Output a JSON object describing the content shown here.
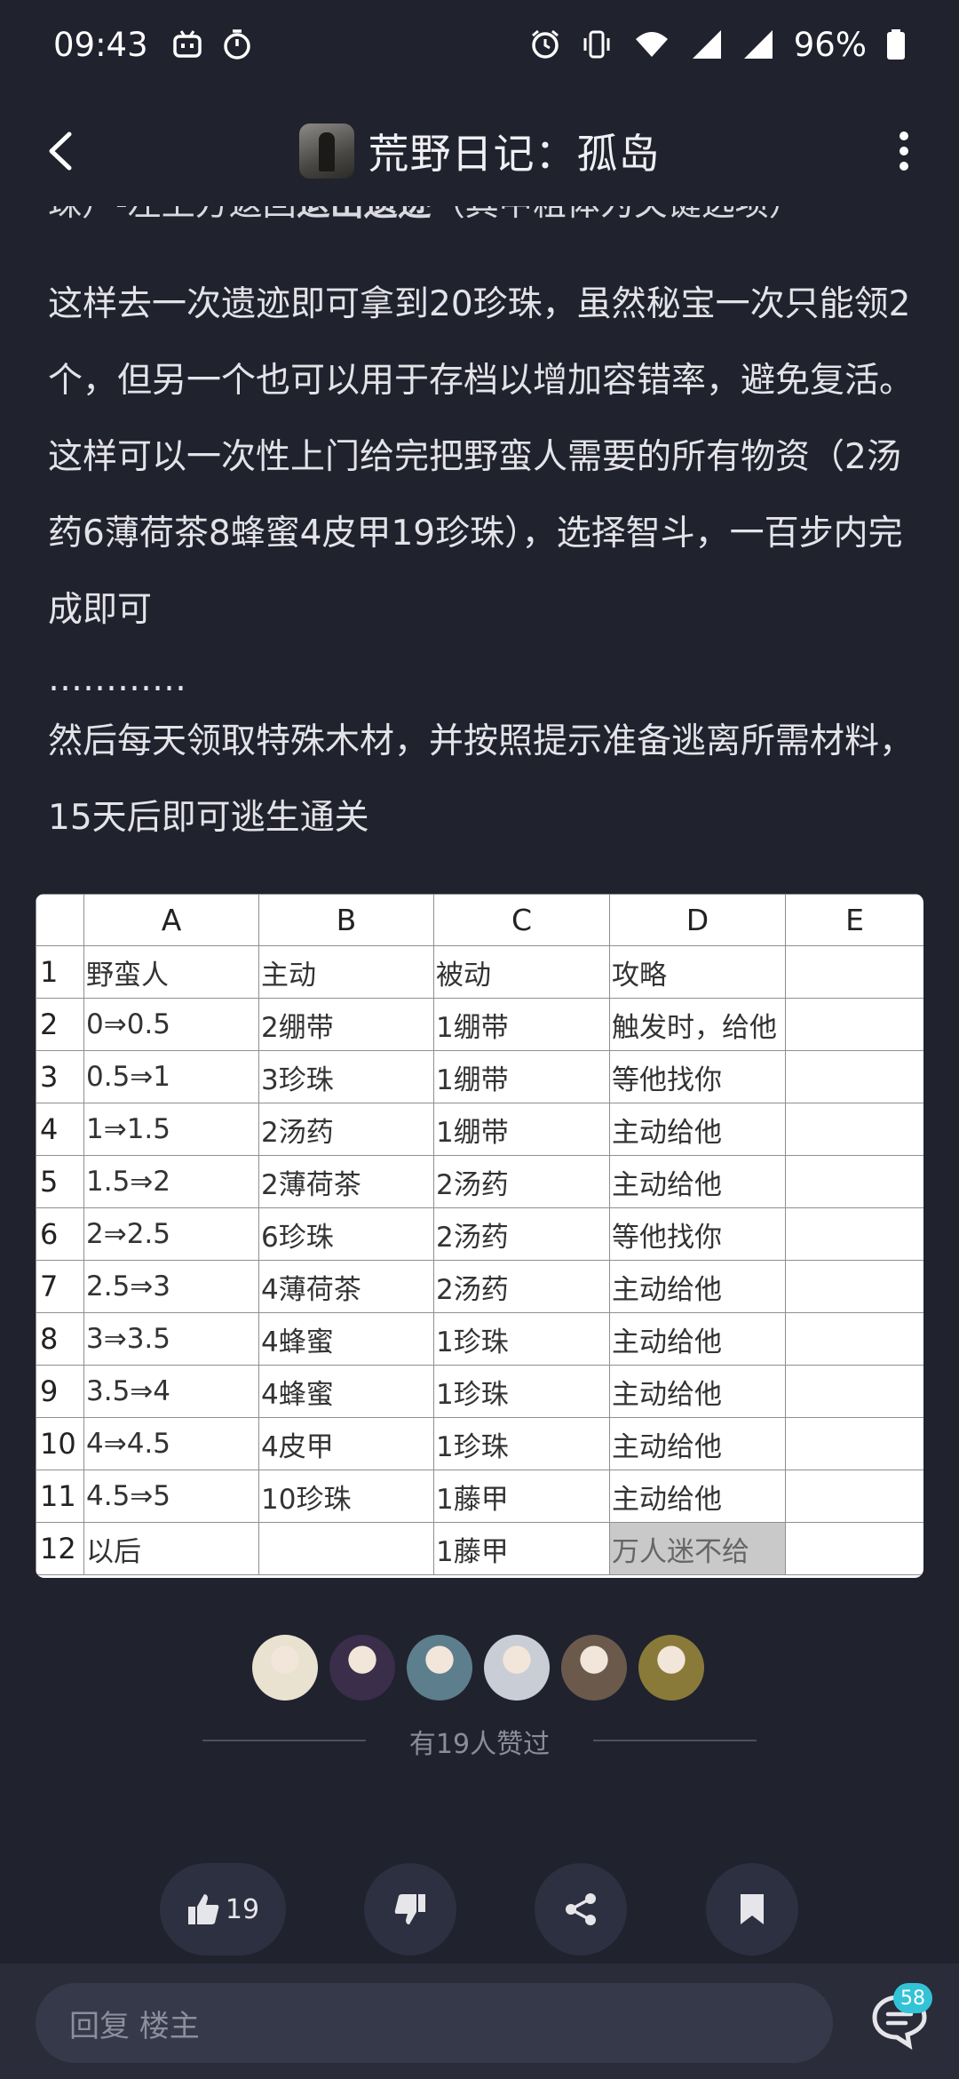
{
  "status_bar": {
    "time": "09:43",
    "battery": "96%",
    "icons": [
      "bilibili-icon",
      "timer-icon",
      "alarm-icon",
      "vibrate-icon",
      "wifi-icon",
      "signal-icon",
      "signal-icon",
      "battery-icon"
    ]
  },
  "header": {
    "title": "荒野日记：孤岛",
    "back_icon": "chevron-left-icon",
    "more_icon": "more-vertical-icon"
  },
  "post": {
    "cut_line_prefix": "珠）-左上方返回",
    "cut_line_bold": "退出遗迹",
    "cut_line_suffix": "（其中粗体为关键选项）",
    "paragraph1": "这样去一次遗迹即可拿到20珍珠，虽然秘宝一次只能领2个，但另一个也可以用于存档以增加容错率，避免复活。这样可以一次性上门给完把野蛮人需要的所有物资（2汤药6薄荷茶8蜂蜜4皮甲19珍珠），选择智斗，一百步内完成即可",
    "dots": "…………",
    "paragraph2": "然后每天领取特殊木材，并按照提示准备逃离所需材料，15天后即可逃生通关"
  },
  "sheet": {
    "columns": [
      "A",
      "B",
      "C",
      "D",
      "E"
    ],
    "rows": [
      {
        "num": "1",
        "a": "野蛮人",
        "b": "主动",
        "c": "被动",
        "d": "攻略",
        "e": ""
      },
      {
        "num": "2",
        "a": "0⇒0.5",
        "b": "2绷带",
        "c": "1绷带",
        "d": "触发时，给他",
        "e": ""
      },
      {
        "num": "3",
        "a": "0.5⇒1",
        "b": "3珍珠",
        "c": "1绷带",
        "d": "等他找你",
        "e": ""
      },
      {
        "num": "4",
        "a": "1⇒1.5",
        "b": "2汤药",
        "c": "1绷带",
        "d": "主动给他",
        "e": ""
      },
      {
        "num": "5",
        "a": "1.5⇒2",
        "b": "2薄荷茶",
        "c": "2汤药",
        "d": "主动给他",
        "e": ""
      },
      {
        "num": "6",
        "a": "2⇒2.5",
        "b": "6珍珠",
        "c": "2汤药",
        "d": "等他找你",
        "e": ""
      },
      {
        "num": "7",
        "a": "2.5⇒3",
        "b": "4薄荷茶",
        "c": "2汤药",
        "d": "主动给他",
        "e": ""
      },
      {
        "num": "8",
        "a": "3⇒3.5",
        "b": "4蜂蜜",
        "c": "1珍珠",
        "d": "主动给他",
        "e": ""
      },
      {
        "num": "9",
        "a": "3.5⇒4",
        "b": "4蜂蜜",
        "c": "1珍珠",
        "d": "主动给他",
        "e": ""
      },
      {
        "num": "10",
        "a": "4⇒4.5",
        "b": "4皮甲",
        "c": "1珍珠",
        "d": "主动给他",
        "e": ""
      },
      {
        "num": "11",
        "a": "4.5⇒5",
        "b": "10珍珠",
        "c": "1藤甲",
        "d": "主动给他",
        "e": ""
      },
      {
        "num": "12",
        "a": "以后",
        "b": "",
        "c": "1藤甲",
        "d": "万人迷不给",
        "e": ""
      }
    ]
  },
  "likes": {
    "text": "有19人赞过",
    "avatar_colors": [
      "#e9e2d0",
      "#3a2e4a",
      "#5d7e8c",
      "#c9ced6",
      "#6b5a4c",
      "#8a7a3a"
    ]
  },
  "actions": {
    "like_count": "19"
  },
  "reply": {
    "placeholder": "回复 楼主",
    "comment_count": "58"
  },
  "colors": {
    "background": "#20222e",
    "button_bg": "#2d3040",
    "badge": "#33c3d6"
  }
}
